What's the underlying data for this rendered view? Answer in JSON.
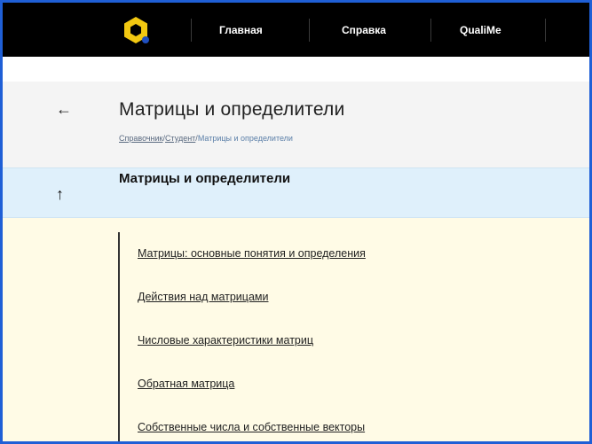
{
  "nav": {
    "items": [
      {
        "label": "Главная"
      },
      {
        "label": "Справка"
      },
      {
        "label": "QualiMe"
      }
    ]
  },
  "header": {
    "title": "Матрицы и определители",
    "breadcrumb": {
      "items": [
        "Справочник",
        "Студент",
        "Матрицы и определители"
      ],
      "separator": "/"
    }
  },
  "section": {
    "title": "Матрицы и определители"
  },
  "toc": {
    "items": [
      "Матрицы: основные понятия и определения",
      "Действия над матрицами",
      "Числовые характеристики матриц",
      "Обратная матрица",
      "Собственные числа и собственные векторы"
    ]
  },
  "icons": {
    "back": "arrow-left-icon",
    "up": "arrow-up-icon",
    "logo": "qualime-logo"
  },
  "colors": {
    "topbar": "#000000",
    "logo_yellow": "#f2c811",
    "logo_blue": "#1f4fbf",
    "section_bg": "#dff0fb",
    "content_bg": "#fffbe6",
    "frame": "#1f5fd6"
  }
}
